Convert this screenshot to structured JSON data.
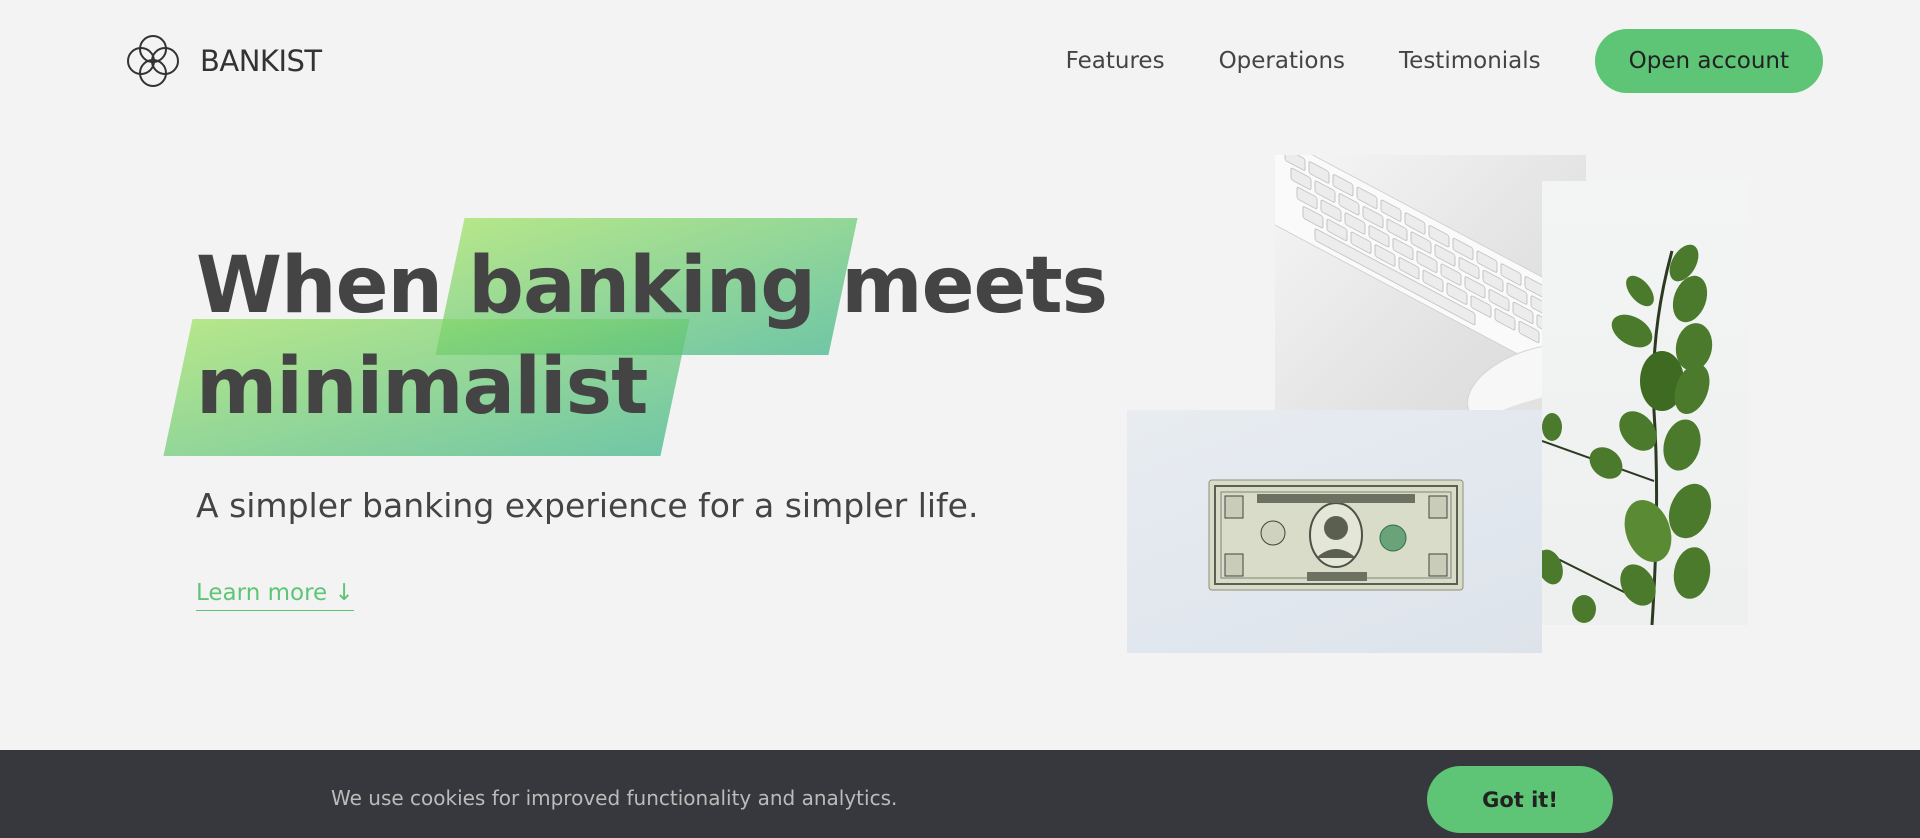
{
  "brand": {
    "name": "BANKIST",
    "logo_icon": "four-circles-logo-icon"
  },
  "nav": {
    "links": [
      "Features",
      "Operations",
      "Testimonials"
    ],
    "cta_label": "Open account"
  },
  "hero": {
    "headline_word1": "When",
    "headline_highlight1": "banking",
    "headline_word2": "meets",
    "headline_highlight2": "minimalist",
    "subtitle": "A simpler banking experience for a simpler life.",
    "learn_more": "Learn more ↓"
  },
  "images": {
    "keyboard": "keyboard-and-mouse-image",
    "dollar": "one-dollar-bill-image",
    "plant": "eucalyptus-branch-image"
  },
  "cookie": {
    "message": "We use cookies for improved functionality and analytics.",
    "button_label": "Got it!"
  },
  "colors": {
    "accent": "#5ec576",
    "background": "#f3f3f3",
    "text": "#444444",
    "cookie_bar": "#37383d",
    "gradient_start": "#9be15d",
    "gradient_end": "#39b385"
  }
}
